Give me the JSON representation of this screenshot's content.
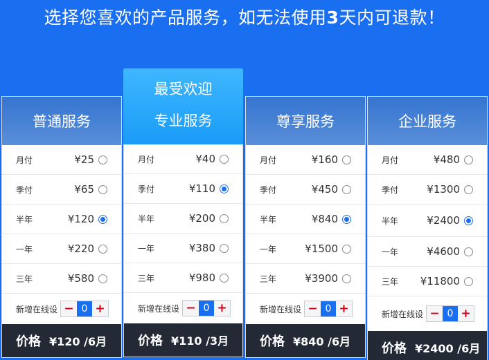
{
  "header": {
    "title_pre": "选择您喜欢的产品服务，如无法使用",
    "title_bold": "3",
    "title_post": "天内可退款！"
  },
  "badge": {
    "label": "最受欢迎"
  },
  "colors": {
    "accent": "#1a6ff0",
    "footer": "#232a36"
  },
  "cards": [
    {
      "name": "普通服务",
      "rows": [
        {
          "label": "月付",
          "price": "¥25",
          "selected": false
        },
        {
          "label": "季付",
          "price": "¥65",
          "selected": false
        },
        {
          "label": "半年",
          "price": "¥120",
          "selected": true
        },
        {
          "label": "一年",
          "price": "¥220",
          "selected": false
        },
        {
          "label": "三年",
          "price": "¥580",
          "selected": false
        }
      ],
      "addon_label": "新增在线设",
      "addon_value": "0",
      "price_label": "价格",
      "price_value": "¥120 /6月"
    },
    {
      "name": "专业服务",
      "rows": [
        {
          "label": "月付",
          "price": "¥40",
          "selected": false
        },
        {
          "label": "季付",
          "price": "¥110",
          "selected": true
        },
        {
          "label": "半年",
          "price": "¥200",
          "selected": false
        },
        {
          "label": "一年",
          "price": "¥380",
          "selected": false
        },
        {
          "label": "三年",
          "price": "¥980",
          "selected": false
        }
      ],
      "addon_label": "新增在线设",
      "addon_value": "0",
      "price_label": "价格",
      "price_value": "¥110 /3月"
    },
    {
      "name": "尊享服务",
      "rows": [
        {
          "label": "月付",
          "price": "¥160",
          "selected": false
        },
        {
          "label": "季付",
          "price": "¥450",
          "selected": false
        },
        {
          "label": "半年",
          "price": "¥840",
          "selected": true
        },
        {
          "label": "一年",
          "price": "¥1500",
          "selected": false
        },
        {
          "label": "三年",
          "price": "¥3900",
          "selected": false
        }
      ],
      "addon_label": "新增在线设",
      "addon_value": "0",
      "price_label": "价格",
      "price_value": "¥840 /6月"
    },
    {
      "name": "企业服务",
      "rows": [
        {
          "label": "月付",
          "price": "¥480",
          "selected": false
        },
        {
          "label": "季付",
          "price": "¥1300",
          "selected": false
        },
        {
          "label": "半年",
          "price": "¥2400",
          "selected": true
        },
        {
          "label": "一年",
          "price": "¥4600",
          "selected": false
        },
        {
          "label": "三年",
          "price": "¥11800",
          "selected": false
        }
      ],
      "addon_label": "新增在线设",
      "addon_value": "0",
      "price_label": "价格",
      "price_value": "¥2400 /6月"
    }
  ],
  "stepper": {
    "minus": "−",
    "plus": "+"
  }
}
